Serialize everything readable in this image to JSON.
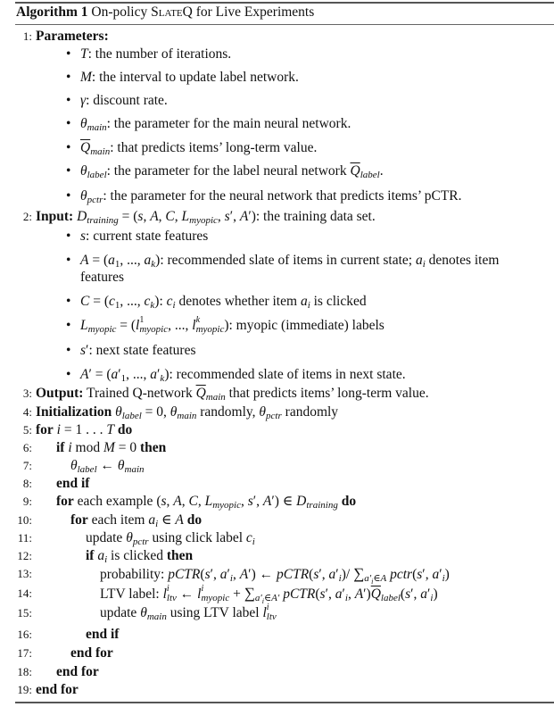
{
  "algorithm": {
    "label": "Algorithm 1",
    "title_pre": "On-policy ",
    "title_sc": "SlateQ",
    "title_post": " for Live Experiments"
  },
  "lines": [
    {
      "num": "1:",
      "keyword": "Parameters:"
    },
    {
      "num": "2:",
      "keyword": "Input:",
      "text": "D_training = (s, A, C, L_myopic, s′, A′): the training data set."
    },
    {
      "num": "3:",
      "keyword": "Output:",
      "text": "Trained Q-network Q̄_main that predicts items’ long-term value."
    },
    {
      "num": "4:",
      "keyword": "Initialization",
      "text": "θ_label = 0, θ_main randomly, θ_pctr randomly"
    },
    {
      "num": "5:",
      "text": "for i = 1 . . . T do"
    },
    {
      "num": "6:",
      "text": "if i mod M = 0 then"
    },
    {
      "num": "7:",
      "text": "θ_label ← θ_main"
    },
    {
      "num": "8:",
      "text": "end if"
    },
    {
      "num": "9:",
      "text": "for each example (s, A, C, L_myopic, s′, A′) ∈ D_training do"
    },
    {
      "num": "10:",
      "text": "for each item a_i ∈ A do"
    },
    {
      "num": "11:",
      "text": "update θ_pctr using click label c_i"
    },
    {
      "num": "12:",
      "text": "if a_i is clicked then"
    },
    {
      "num": "13:",
      "text": "probability: pCTR(s′, a′_i, A′) ← pCTR(s′, a′_i)/ Σ_{a′_i∈A} pctr(s′, a′_i)"
    },
    {
      "num": "14:",
      "text": "LTV label: l^i_ltv ← l^i_myopic + Σ_{a′_i∈A′} pCTR(s′, a′_i, A′) Q̄_label(s′, a′_i)"
    },
    {
      "num": "15:",
      "text": "update θ_main using LTV label l^i_ltv"
    },
    {
      "num": "16:",
      "text": "end if"
    },
    {
      "num": "17:",
      "text": "end for"
    },
    {
      "num": "18:",
      "text": "end for"
    },
    {
      "num": "19:",
      "text": "end for"
    }
  ],
  "parameters": [
    {
      "sym": "T",
      "desc": ": the number of iterations."
    },
    {
      "sym": "M",
      "desc": ": the interval to update label network."
    },
    {
      "sym": "γ",
      "desc": ": discount rate."
    },
    {
      "sym": "θ",
      "sub": "main",
      "desc": ": the parameter for the main neural network."
    },
    {
      "sym": "Q",
      "sub": "main",
      "desc": ": that predicts items’ long-term value."
    },
    {
      "sym": "θ",
      "sub": "label",
      "desc": ": the parameter for the label neural network "
    },
    {
      "sym": "θ",
      "sub": "pctr",
      "desc": ": the parameter for the neural network that predicts items’ pCTR."
    }
  ],
  "inputs": [
    {
      "desc": ": current state features"
    },
    {
      "desc": ": recommended slate of items in current state; ",
      "desc2": " denotes item",
      "cont": "features"
    },
    {
      "desc": ": ",
      "desc2": " denotes whether item ",
      "desc3": " is clicked"
    },
    {
      "desc": ": myopic (immediate) labels"
    },
    {
      "desc": ": next state features"
    },
    {
      "desc": ": recommended slate of items in next state."
    }
  ],
  "words": {
    "bullet": "•",
    "randomly": "randomly",
    "for": "for",
    "do": "do",
    "if": "if",
    "then": "then",
    "end_if": "end if",
    "end_for": "end for",
    "mod": "mod",
    "each_example": "each example",
    "each_item": "each item",
    "update": "update",
    "using_click_label": "using click label",
    "is_clicked": "is clicked",
    "probability": "probability:",
    "ltv_label": "LTV label:",
    "using_ltv_label": "using LTV label",
    "training_set": ": the training data set.",
    "trained_q": "Trained Q-network",
    "predicts": "that predicts items’ long-term value."
  }
}
